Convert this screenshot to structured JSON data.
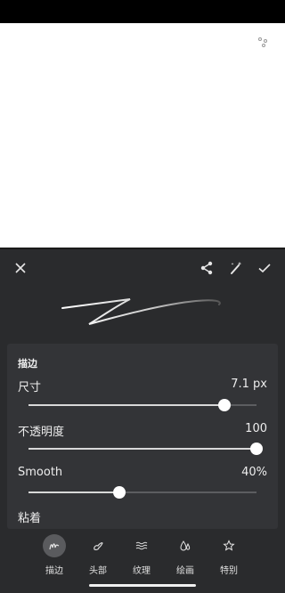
{
  "panel": {
    "section_title": "描边",
    "rows": [
      {
        "label": "尺寸",
        "value": "7.1 px",
        "level": 0.86
      },
      {
        "label": "不透明度",
        "value": "100",
        "level": 1.0
      },
      {
        "label": "Smooth",
        "value": "40%",
        "level": 0.4
      }
    ],
    "partial_row_label": "粘着"
  },
  "tabs": [
    {
      "label": "描边",
      "icon": "stroke-icon",
      "active": true
    },
    {
      "label": "头部",
      "icon": "brush-head-icon",
      "active": false
    },
    {
      "label": "纹理",
      "icon": "waves-icon",
      "active": false
    },
    {
      "label": "绘画",
      "icon": "droplets-icon",
      "active": false
    },
    {
      "label": "特别",
      "icon": "star-icon",
      "active": false
    }
  ],
  "toolbar_icons": [
    "close-icon",
    "share-icon",
    "magic-brush-icon",
    "check-icon"
  ],
  "colors": {
    "panel": "#2a2b2d",
    "card": "#333437",
    "accent": "#ffffff"
  }
}
